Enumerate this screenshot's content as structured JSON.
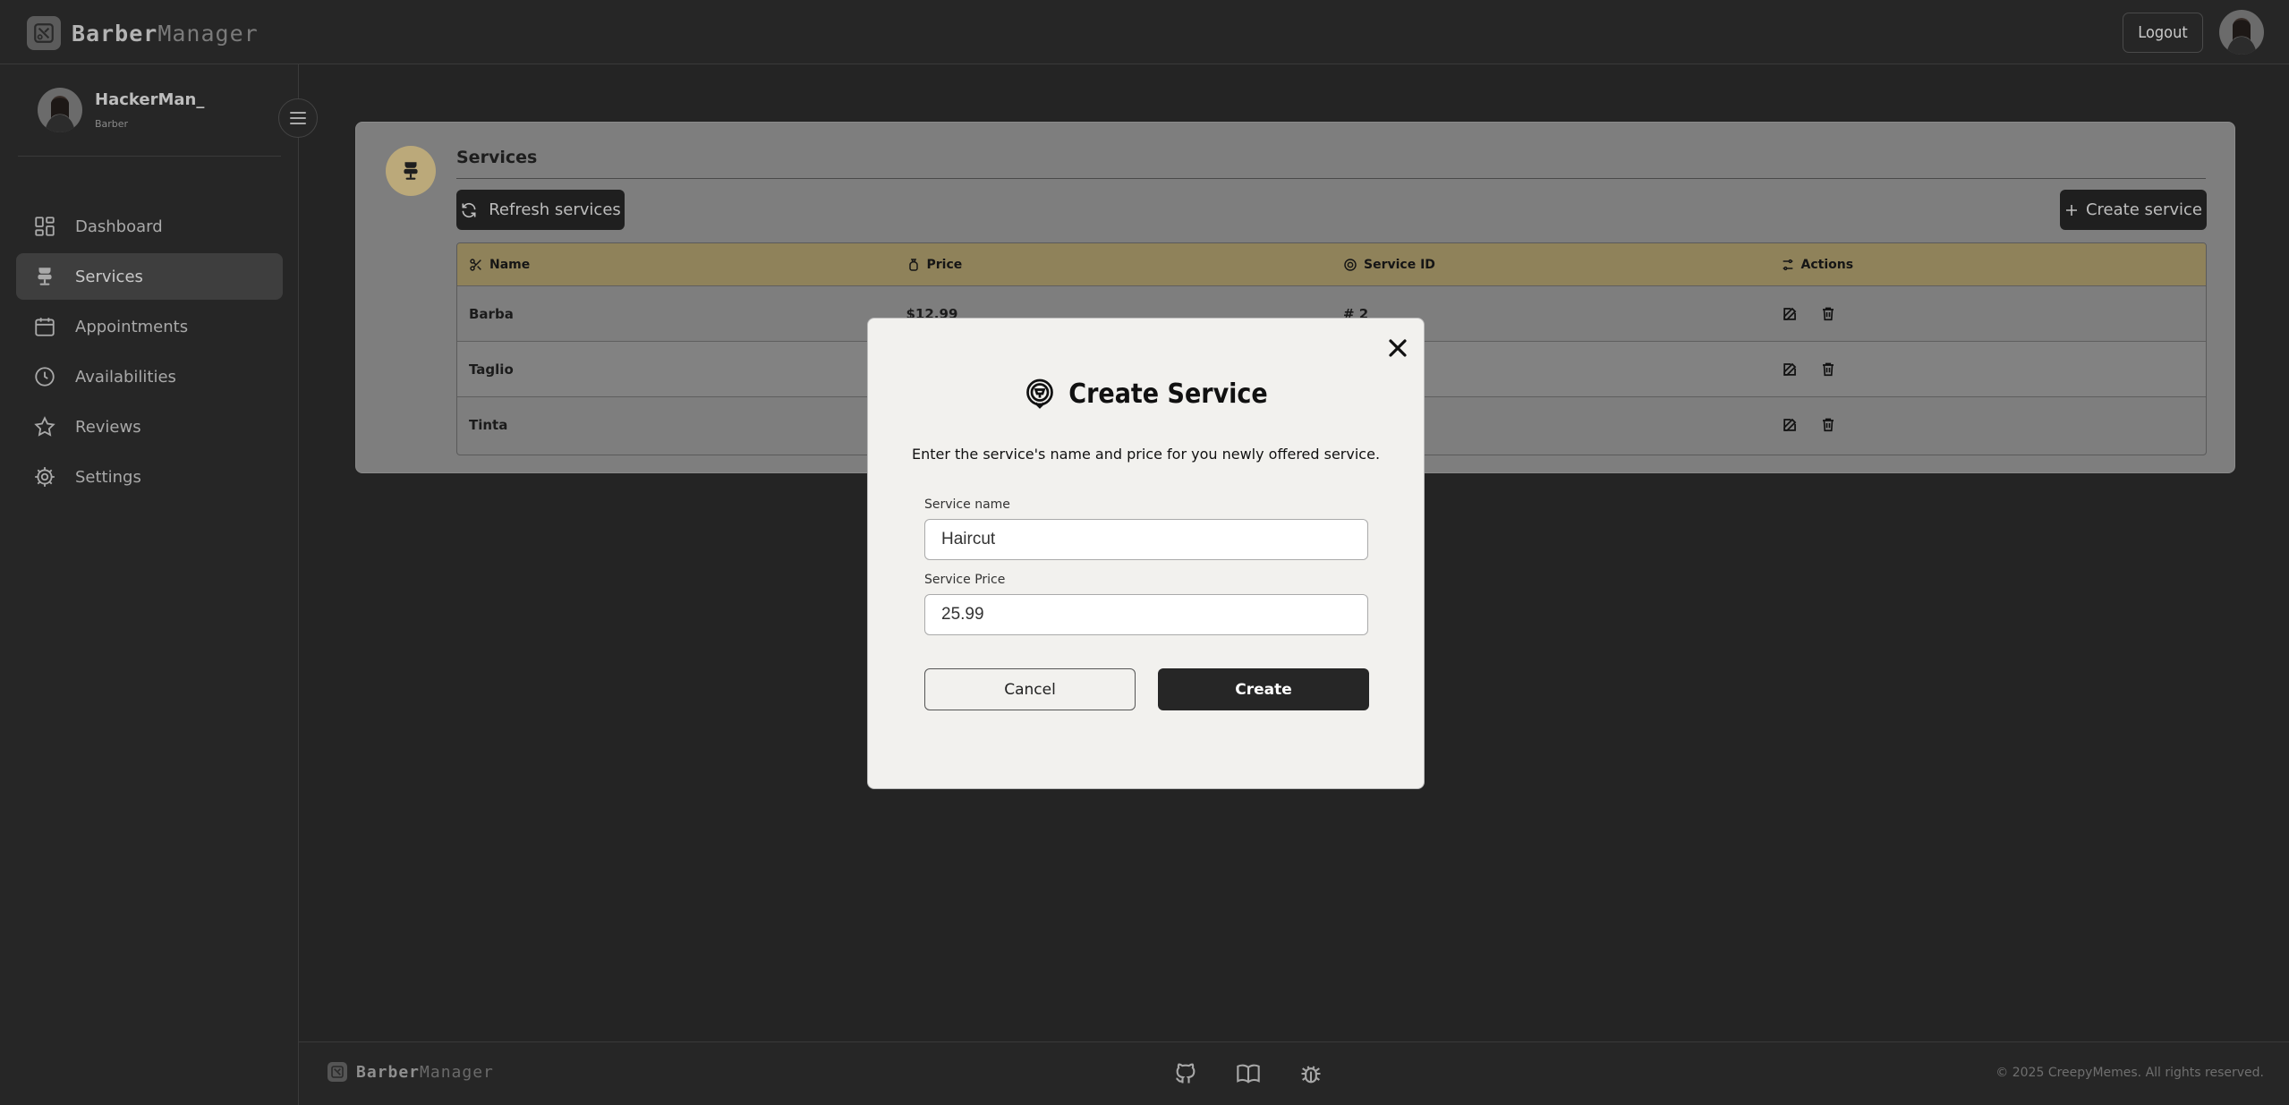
{
  "app": {
    "brand_primary": "Barber",
    "brand_secondary": "Manager",
    "logout_label": "Logout"
  },
  "user": {
    "name": "HackerMan_",
    "role": "Barber"
  },
  "sidebar": {
    "items": [
      {
        "label": "Dashboard",
        "icon": "dashboard-icon"
      },
      {
        "label": "Services",
        "icon": "barber-chair-icon",
        "active": true
      },
      {
        "label": "Appointments",
        "icon": "calendar-icon"
      },
      {
        "label": "Availabilities",
        "icon": "clock-icon"
      },
      {
        "label": "Reviews",
        "icon": "star-icon"
      },
      {
        "label": "Settings",
        "icon": "gear-icon"
      }
    ]
  },
  "services_card": {
    "title": "Services",
    "refresh_label": "Refresh services",
    "create_label": "Create service",
    "columns": [
      "Name",
      "Price",
      "Service ID",
      "Actions"
    ],
    "rows": [
      {
        "name": "Barba",
        "price": "$12.99",
        "id": "# 2"
      },
      {
        "name": "Taglio",
        "price": "",
        "id": ""
      },
      {
        "name": "Tinta",
        "price": "",
        "id": ""
      }
    ]
  },
  "modal": {
    "title": "Create Service",
    "description": "Enter the service's name and price for you newly offered service.",
    "name_label": "Service name",
    "name_value": "Haircut",
    "price_label": "Service Price",
    "price_value": "25.99",
    "cancel_label": "Cancel",
    "create_label": "Create"
  },
  "footer": {
    "brand_primary": "Barber",
    "brand_secondary": "Manager",
    "copyright": "© 2025 CreepyMemes. All rights reserved."
  },
  "colors": {
    "background": "#242424",
    "accent_gold": "#bba97a",
    "table_header": "#8f825a"
  }
}
